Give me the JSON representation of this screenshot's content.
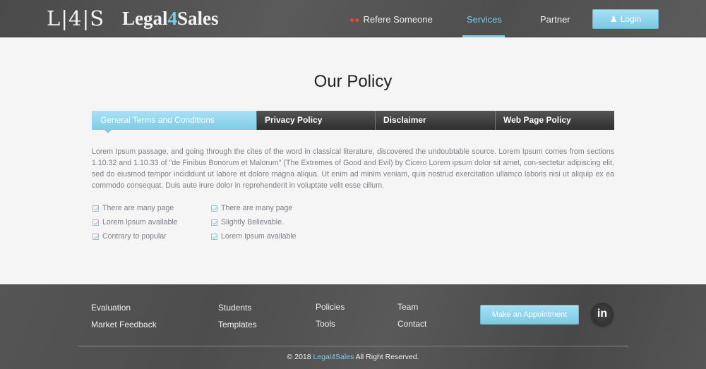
{
  "header": {
    "logo_mark": "L|4|S",
    "logo_text_a": "Legal",
    "logo_text_b": "4",
    "logo_text_c": "Sales",
    "nav": [
      {
        "label": "Refere Someone",
        "icon": "users-icon"
      },
      {
        "label": "Services",
        "active": true
      },
      {
        "label": "Partner"
      }
    ],
    "login_label": "Login"
  },
  "main": {
    "title": "Our Policy",
    "tabs": [
      {
        "label": "General Terms and Conditions",
        "active": true
      },
      {
        "label": "Privacy Policy"
      },
      {
        "label": "Disclaimer"
      },
      {
        "label": "Web Page Policy"
      }
    ],
    "paragraph": "Lorem Ipsum passage, and going through the cites of the word in classical literature, discovered the undoubtable source. Lorem Ipsum comes from sections 1.10.32 and 1.10.33 of \"de Finibus Bonorum et Malorum\" (The Extremes of Good and Evil) by Cicero Lorem ipsum dolor sit amet, con-sectetur adipiscing elit, sed do eiusmod tempor incididunt ut labore et dolore magna aliqua. Ut enim ad minim veniam, quis nostrud exercitation ullamco laboris nisi ut aliquip ex ea commodo consequat. Duis aute irure dolor in reprehenderit in voluptate velit esse cillum.",
    "checklist_left": [
      "There are many page",
      "Lorem Ipsum available",
      "Contrary to popular"
    ],
    "checklist_right": [
      "There are many page",
      "Slightly Believable.",
      "Lorem Ipsum available"
    ]
  },
  "footer": {
    "links": [
      "Evaluation",
      "Market Feedback",
      "Students",
      "Templates",
      "Policies",
      "Tools",
      "Team",
      "Contact"
    ],
    "appointment_label": "Make an Appointment",
    "linkedin_label": "in",
    "copyright_pre": "© 2018",
    "copyright_brand": "Legal4Sales",
    "copyright_post": "All Right Reserved."
  },
  "colors": {
    "accent": "#7fcbe6",
    "refer_icon": "#e94040"
  }
}
